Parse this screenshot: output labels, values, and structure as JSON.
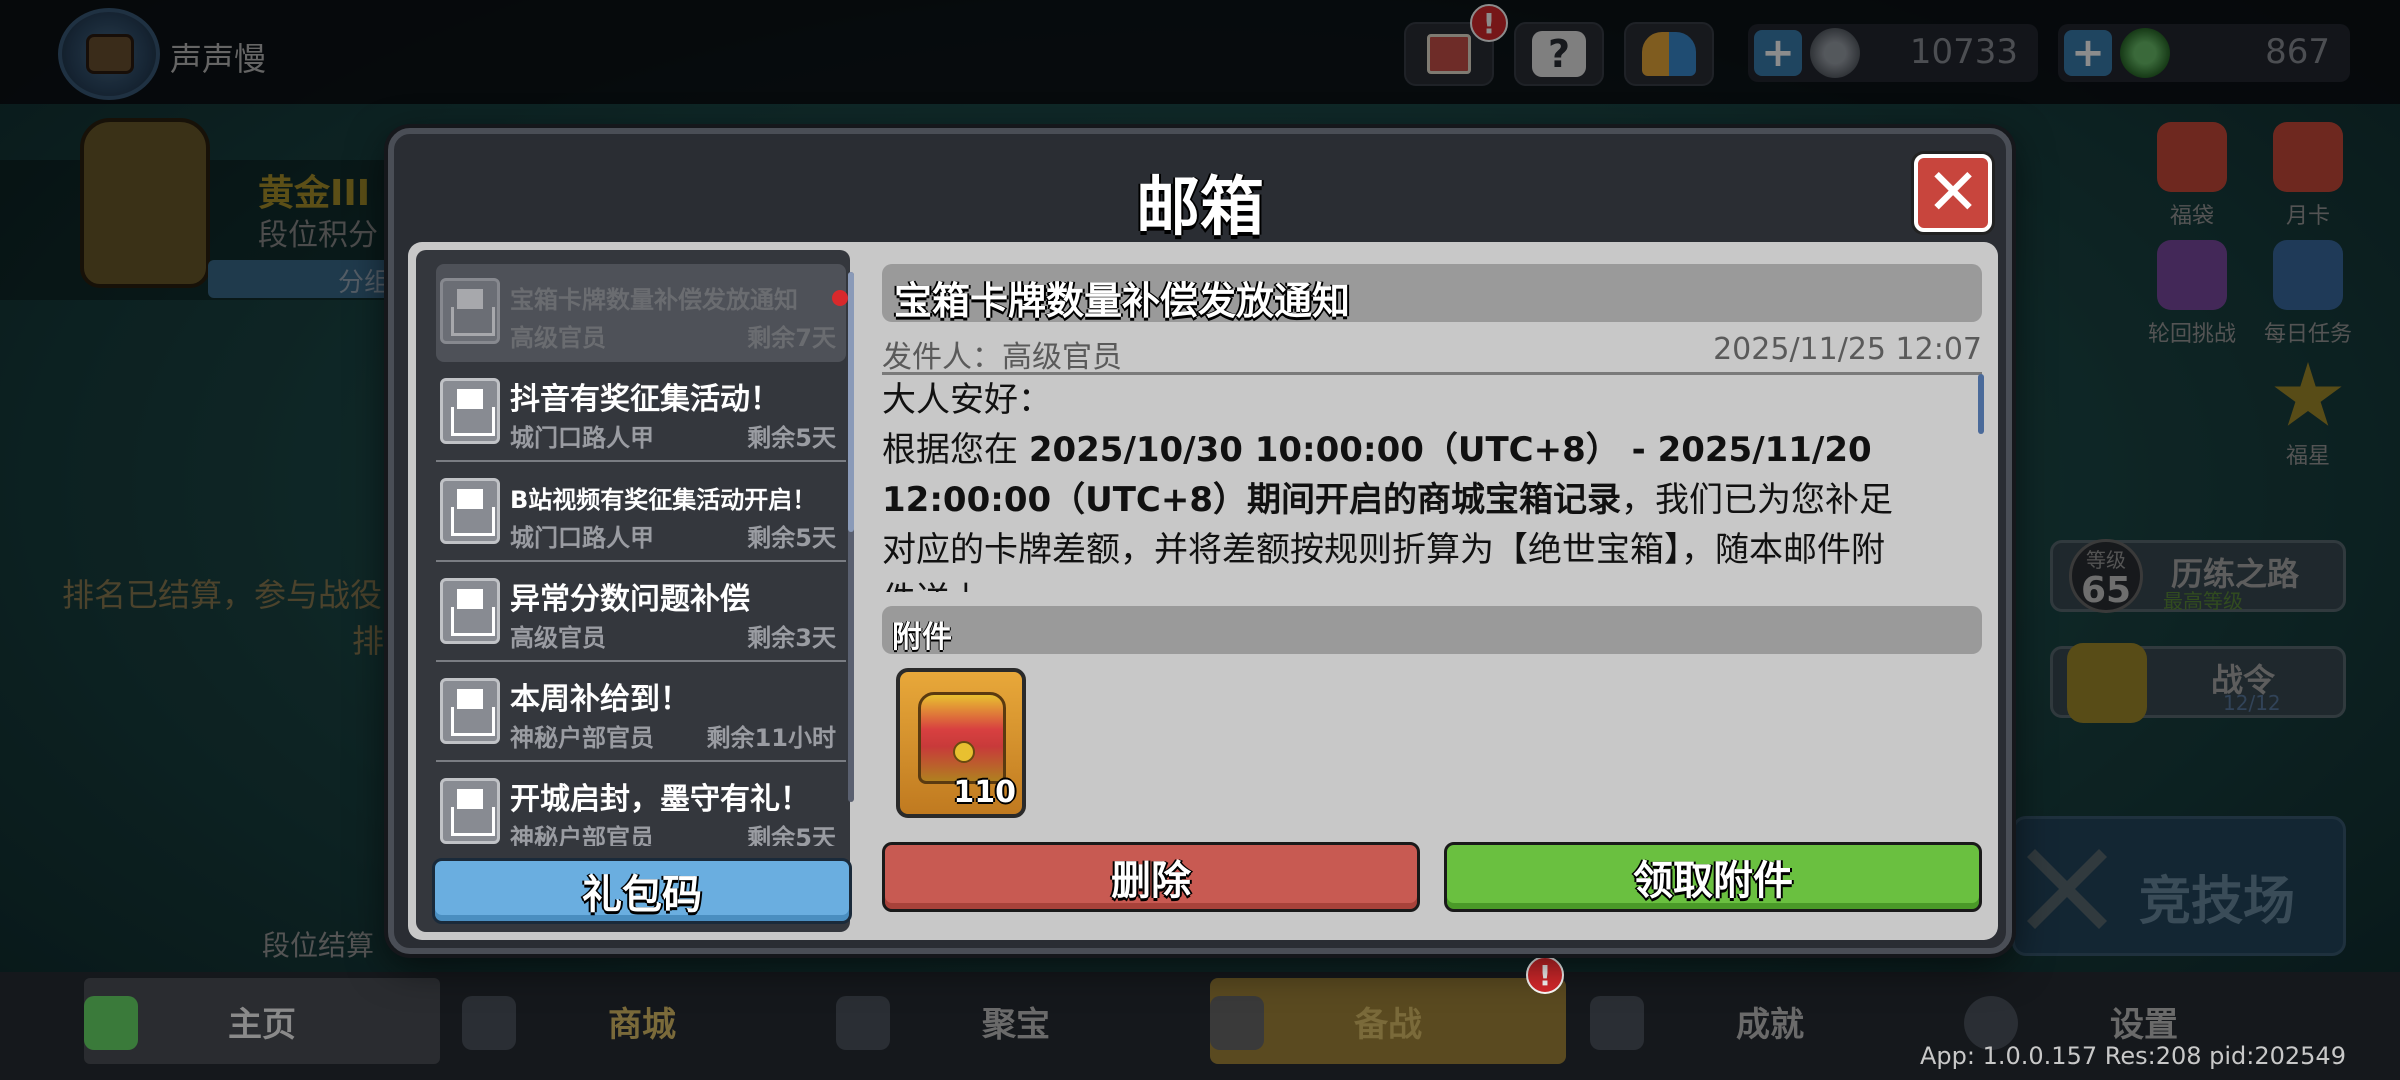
{
  "player": {
    "name": "声声慢"
  },
  "top_buttons": [
    {
      "icon": "book-icon",
      "badge": "!"
    },
    {
      "icon": "help-icon"
    },
    {
      "icon": "friends-icon"
    }
  ],
  "currencies": [
    {
      "icon": "coin-icon",
      "value": "10733"
    },
    {
      "icon": "gem-icon",
      "value": "867"
    }
  ],
  "rank": {
    "name": "黄金III",
    "score_label": "段位积分",
    "bar_label": "分组",
    "ended_text_1": "排名已结算，参与战役",
    "ended_text_2": "排",
    "settle_label": "段位结算"
  },
  "right_side": {
    "items": [
      {
        "label": "福袋"
      },
      {
        "label": "月卡"
      },
      {
        "label": "轮回挑战"
      },
      {
        "label": "每日任务"
      },
      {
        "label": "福星"
      }
    ],
    "level_label": "等级",
    "level_value": "65",
    "trial_title": "历练之路",
    "trial_sub": "最高等级",
    "pass_title": "战令",
    "pass_progress": "12/12",
    "arena_label": "竞技场"
  },
  "mailbox": {
    "title": "邮箱",
    "close_icon": "close-icon",
    "gift_code_label": "礼包码",
    "mails": [
      {
        "title": "宝箱卡牌数量补偿发放通知",
        "sender": "高级官员",
        "remaining": "剩余7天",
        "selected": true,
        "unread": true
      },
      {
        "title": "抖音有奖征集活动！",
        "sender": "城门口路人甲",
        "remaining": "剩余5天"
      },
      {
        "title": "B站视频有奖征集活动开启！",
        "sender": "城门口路人甲",
        "remaining": "剩余5天"
      },
      {
        "title": "异常分数问题补偿",
        "sender": "高级官员",
        "remaining": "剩余3天"
      },
      {
        "title": "本周补给到！",
        "sender": "神秘户部官员",
        "remaining": "剩余11小时"
      },
      {
        "title": "开城启封，墨守有礼！",
        "sender": "神秘户部官员",
        "remaining": "剩余5天"
      }
    ],
    "detail": {
      "title": "宝箱卡牌数量补偿发放通知",
      "sender_label": "发件人：高级官员",
      "date": "2025/11/25 12:07",
      "lines": [
        {
          "normal": "大人安好："
        },
        {
          "normal": "根据您在 ",
          "bold": "2025/10/30 10:00:00（UTC+8） - 2025/11/20"
        },
        {
          "bold": "12:00:00（UTC+8）期间开启的商城宝箱记录",
          "normal": "，我们已为您补足"
        },
        {
          "normal": "对应的卡牌差额，并将差额按规则折算为【绝世宝箱】，随本邮件附"
        },
        {
          "normal": "件送上"
        }
      ],
      "attachment_label": "附件",
      "attachments": [
        {
          "icon": "treasure-chest-icon",
          "count": "110"
        }
      ],
      "delete_label": "删除",
      "claim_label": "领取附件"
    }
  },
  "bottom_nav": [
    {
      "label": "主页",
      "icon": "home-icon",
      "active": true
    },
    {
      "label": "商城",
      "icon": "coins-icon"
    },
    {
      "label": "聚宝",
      "icon": "treasure-bowl-icon"
    },
    {
      "label": "备战",
      "icon": "cards-icon",
      "badge": "!"
    },
    {
      "label": "成就",
      "icon": "achievement-icon"
    },
    {
      "label": "设置",
      "icon": "gear-icon"
    }
  ],
  "version_text": "App: 1.0.0.157 Res:208 pid:202549"
}
